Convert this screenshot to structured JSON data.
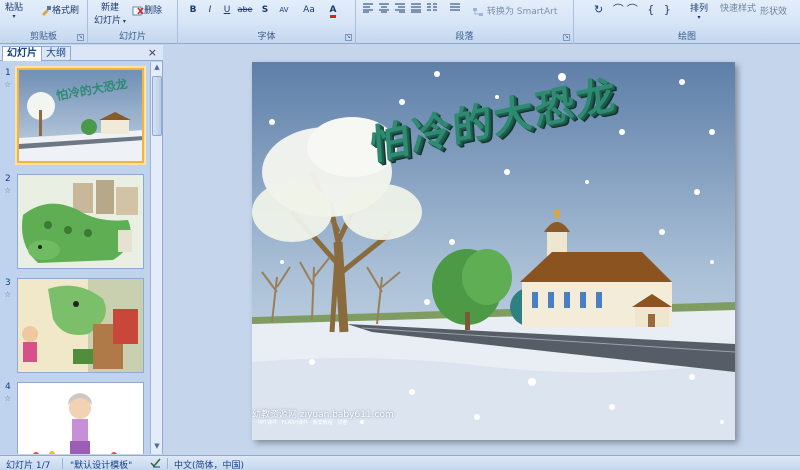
{
  "ribbon": {
    "clipboard": {
      "paste_label": "粘贴",
      "format_painter_label": "格式刷",
      "group_label": "剪贴板"
    },
    "slides": {
      "new_slide_label": "新建",
      "new_slide_label2": "幻灯片",
      "delete_label": "删除",
      "group_label": "幻灯片"
    },
    "font": {
      "bold": "B",
      "italic": "I",
      "underline": "U",
      "strike": "abe",
      "shadow": "S",
      "spacing": "AV",
      "case": "Aa",
      "group_label": "字体"
    },
    "paragraph": {
      "smartart_label": "转换为 SmartArt",
      "group_label": "段落"
    },
    "drawing": {
      "arrange_label": "排列",
      "quick_styles_label": "快速样式",
      "shape_effects_label": "形状效",
      "group_label": "绘图"
    }
  },
  "panel": {
    "tabs": [
      {
        "label": "幻灯片"
      },
      {
        "label": "大纲"
      }
    ],
    "close_glyph": "×",
    "thumbnails": [
      {
        "number": "1"
      },
      {
        "number": "2"
      },
      {
        "number": "3"
      },
      {
        "number": "4"
      }
    ]
  },
  "slide": {
    "title": "怕冷的大恐龙",
    "watermark": "幼教资源网 ziyuan.baby611.com",
    "watermark_sub": "PPT课件 · FLASH课件 · 教案教程 · 试卷"
  },
  "statusbar": {
    "slide_indicator": "幻灯片 1/7",
    "theme": "\"默认设计模板\"",
    "language": "中文(简体，中国)"
  },
  "colors": {
    "ribbon_bg": "#d6e4f6",
    "panel_bg": "#bfd3ee",
    "active_thumb_border": "#f6b23c",
    "title_green": "#2f8a72"
  }
}
